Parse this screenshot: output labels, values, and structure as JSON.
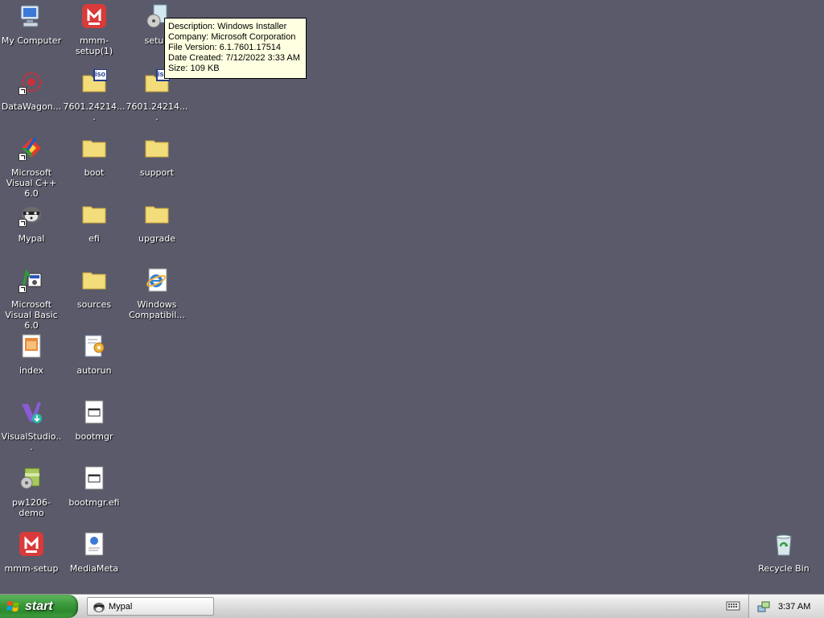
{
  "desktop": {
    "icons": {
      "my_computer": "My Computer",
      "mmm_setup_1": "mmm-setup(1)",
      "setup": "setup",
      "datawagon": "DataWagon...",
      "iso_1": "7601.24214....",
      "iso_2": "7601.24214....",
      "msvc": "Microsoft Visual C++ 6.0",
      "boot": "boot",
      "support": "support",
      "mypal": "Mypal",
      "efi": "efi",
      "upgrade": "upgrade",
      "msvb": "Microsoft Visual Basic 6.0",
      "sources": "sources",
      "windows_compat": "Windows Compatibil...",
      "index": "index",
      "autorun": "autorun",
      "visualstudio": "VisualStudio...",
      "bootmgr": "bootmgr",
      "pw1206": "pw1206-demo",
      "bootmgr_efi": "bootmgr.efi",
      "mmm_setup": "mmm-setup",
      "mediameta": "MediaMeta",
      "recycle_bin": "Recycle Bin"
    },
    "iso_badge": "iso"
  },
  "tooltip": {
    "description": "Description: Windows Installer",
    "company": "Company: Microsoft Corporation",
    "file_version": "File Version: 6.1.7601.17514",
    "date_created": "Date Created: 7/12/2022 3:33 AM",
    "size": "Size: 109 KB"
  },
  "taskbar": {
    "start_label": "start",
    "tasks": [
      {
        "label": "Mypal"
      }
    ],
    "clock": "3:37 AM"
  },
  "colors": {
    "desktop_background": "#5a5a6b",
    "start_button": "#3c9a3c",
    "tooltip_background": "#ffffe1"
  }
}
